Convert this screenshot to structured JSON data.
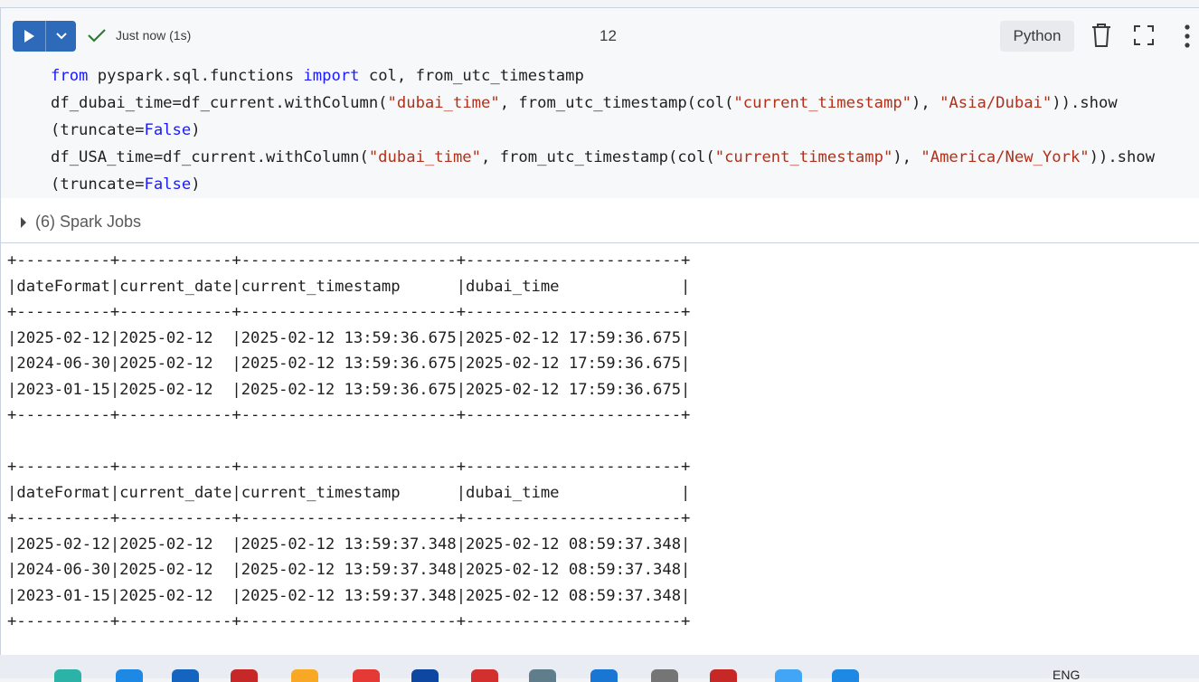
{
  "toolbar": {
    "status_text": "Just now (1s)",
    "cell_number": "12",
    "language": "Python"
  },
  "code_lines": [
    [
      [
        "kw",
        "from"
      ],
      [
        "t",
        " pyspark.sql.functions "
      ],
      [
        "kw",
        "import"
      ],
      [
        "t",
        " col, from_utc_timestamp"
      ]
    ],
    [
      [
        "t",
        "df_dubai_time=df_current.withColumn("
      ],
      [
        "str",
        "\"dubai_time\""
      ],
      [
        "t",
        ", from_utc_timestamp(col("
      ],
      [
        "str",
        "\"current_timestamp\""
      ],
      [
        "t",
        "), "
      ],
      [
        "str",
        "\"Asia/Dubai\""
      ],
      [
        "t",
        ")).show"
      ]
    ],
    [
      [
        "t",
        "(truncate="
      ],
      [
        "cst",
        "False"
      ],
      [
        "t",
        ")"
      ]
    ],
    [
      [
        "t",
        "df_USA_time=df_current.withColumn("
      ],
      [
        "str",
        "\"dubai_time\""
      ],
      [
        "t",
        ", from_utc_timestamp(col("
      ],
      [
        "str",
        "\"current_timestamp\""
      ],
      [
        "t",
        "), "
      ],
      [
        "str",
        "\"America/New_York\""
      ],
      [
        "t",
        ")).show"
      ]
    ],
    [
      [
        "t",
        "(truncate="
      ],
      [
        "cst",
        "False"
      ],
      [
        "t",
        ")"
      ]
    ]
  ],
  "spark_jobs_label": "(6) Spark Jobs",
  "output_lines": [
    "+----------+------------+-----------------------+-----------------------+",
    "|dateFormat|current_date|current_timestamp      |dubai_time             |",
    "+----------+------------+-----------------------+-----------------------+",
    "|2025-02-12|2025-02-12  |2025-02-12 13:59:36.675|2025-02-12 17:59:36.675|",
    "|2024-06-30|2025-02-12  |2025-02-12 13:59:36.675|2025-02-12 17:59:36.675|",
    "|2023-01-15|2025-02-12  |2025-02-12 13:59:36.675|2025-02-12 17:59:36.675|",
    "+----------+------------+-----------------------+-----------------------+",
    "",
    "+----------+------------+-----------------------+-----------------------+",
    "|dateFormat|current_date|current_timestamp      |dubai_time             |",
    "+----------+------------+-----------------------+-----------------------+",
    "|2025-02-12|2025-02-12  |2025-02-12 13:59:37.348|2025-02-12 08:59:37.348|",
    "|2024-06-30|2025-02-12  |2025-02-12 13:59:37.348|2025-02-12 08:59:37.348|",
    "|2023-01-15|2025-02-12  |2025-02-12 13:59:37.348|2025-02-12 08:59:37.348|",
    "+----------+------------+-----------------------+-----------------------+"
  ],
  "taskbar": {
    "language_indicator": "ENG",
    "apps": [
      "copilot-icon",
      "edge-icon",
      "store-icon",
      "gmail-icon",
      "folder-icon",
      "calendar-icon",
      "outlook-icon",
      "chrome-icon",
      "teams-icon",
      "azure-icon",
      "settings-icon",
      "chrome-profile-icon",
      "mail-icon",
      "notepad-icon"
    ]
  },
  "colors": {
    "accent": "#2d6ab9",
    "keyword": "#1a1aff",
    "string": "#b2301a",
    "check": "#2e7d32"
  }
}
